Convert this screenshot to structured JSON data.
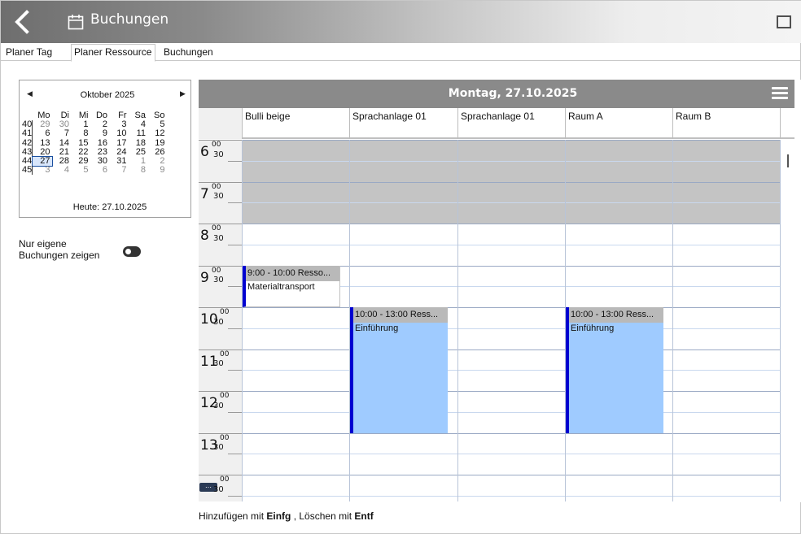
{
  "window": {
    "title": "Buchungen",
    "back_icon": "chevron-left-icon",
    "calendar_icon": "calendar-icon",
    "maximize_icon": "maximize-icon"
  },
  "tabs": [
    {
      "label": "Planer Tag",
      "active": false
    },
    {
      "label": "Planer Ressource",
      "active": true
    },
    {
      "label": "Buchungen",
      "active": false
    }
  ],
  "mini_calendar": {
    "title": "Oktober 2025",
    "prev_icon": "caret-left-icon",
    "next_icon": "caret-right-icon",
    "weekdays": [
      "Mo",
      "Di",
      "Mi",
      "Do",
      "Fr",
      "Sa",
      "So"
    ],
    "weeks": [
      {
        "wk": "40",
        "days": [
          "29",
          "30",
          "1",
          "2",
          "3",
          "4",
          "5"
        ]
      },
      {
        "wk": "41",
        "days": [
          "6",
          "7",
          "8",
          "9",
          "10",
          "11",
          "12"
        ]
      },
      {
        "wk": "42",
        "days": [
          "13",
          "14",
          "15",
          "16",
          "17",
          "18",
          "19"
        ]
      },
      {
        "wk": "43",
        "days": [
          "20",
          "21",
          "22",
          "23",
          "24",
          "25",
          "26"
        ]
      },
      {
        "wk": "44",
        "days": [
          "27",
          "28",
          "29",
          "30",
          "31",
          "1",
          "2"
        ]
      },
      {
        "wk": "45",
        "days": [
          "3",
          "4",
          "5",
          "6",
          "7",
          "8",
          "9"
        ]
      }
    ],
    "today_label": "Heute: 27.10.2025"
  },
  "filter": {
    "label": "Nur eigene Buchungen zeigen",
    "enabled": false
  },
  "planner": {
    "date_title": "Montag, 27.10.2025",
    "menu_icon": "hamburger-menu-icon",
    "resources": [
      "Bulli beige",
      "Sprachanlage 01",
      "Sprachanlage 01",
      "Raum A",
      "Raum B"
    ],
    "hours": [
      {
        "hour": "6",
        "min": "00",
        "half": "30"
      },
      {
        "hour": "7",
        "min": "00",
        "half": "30"
      },
      {
        "hour": "8",
        "min": "00",
        "half": "30"
      },
      {
        "hour": "9",
        "min": "00",
        "half": "30"
      },
      {
        "hour": "10",
        "min": "00",
        "half": "30"
      },
      {
        "hour": "11",
        "min": "00",
        "half": "30"
      },
      {
        "hour": "12",
        "min": "00",
        "half": "30"
      },
      {
        "hour": "13",
        "min": "00",
        "half": "30"
      },
      {
        "hour": "",
        "min": "00",
        "half": "30"
      }
    ],
    "appointments": [
      {
        "resource": 0,
        "start": "9:00",
        "end": "10:00",
        "header": "9:00 - 10:00 Resso...",
        "text": "Materialtransport",
        "color": "#ffffff"
      },
      {
        "resource": 1,
        "start": "10:00",
        "end": "13:00",
        "header": "10:00 - 13:00 Ress...",
        "text": "Einführung",
        "color": "#9fcbff"
      },
      {
        "resource": 3,
        "start": "10:00",
        "end": "13:00",
        "header": "10:00 - 13:00 Ress...",
        "text": "Einführung",
        "color": "#9fcbff"
      }
    ],
    "more_icon": "more-dots-icon"
  },
  "footer": {
    "text_a": "Hinzufügen mit ",
    "key_a": "Einfg",
    "text_b": " , Löschen mit ",
    "key_b": "Entf"
  }
}
